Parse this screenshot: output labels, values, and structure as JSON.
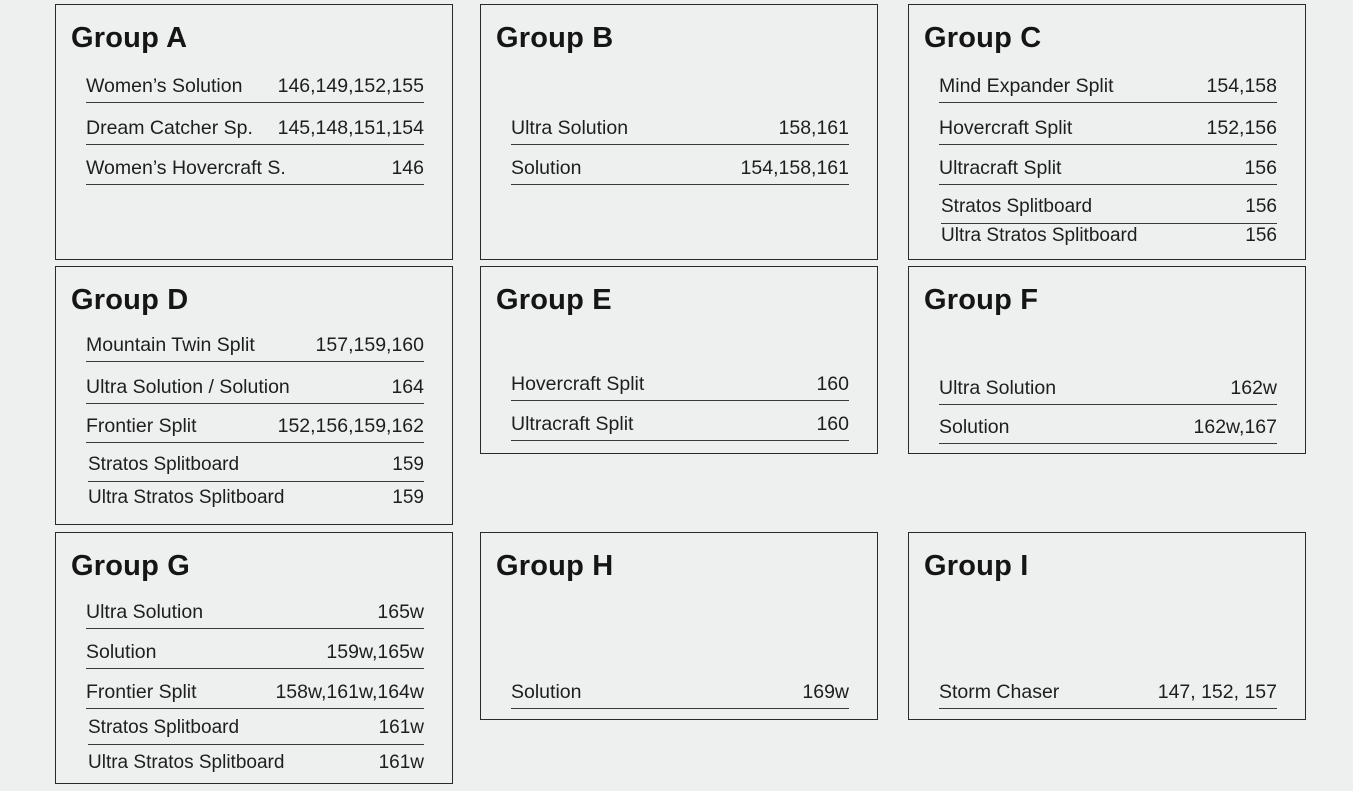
{
  "groups": [
    {
      "title": "Group A",
      "rows": [
        {
          "name": "Women’s Solution",
          "sizes": "146,149,152,155"
        },
        {
          "name": "Dream Catcher Sp.",
          "sizes": "145,148,151,154"
        },
        {
          "name": "Women’s Hovercraft S.",
          "sizes": "146"
        }
      ]
    },
    {
      "title": "Group B",
      "rows": [
        {
          "name": "Ultra Solution",
          "sizes": "158,161"
        },
        {
          "name": "Solution",
          "sizes": "154,158,161"
        }
      ]
    },
    {
      "title": "Group C",
      "rows": [
        {
          "name": "Mind Expander Split",
          "sizes": "154,158"
        },
        {
          "name": "Hovercraft Split",
          "sizes": "152,156"
        },
        {
          "name": "Ultracraft Split",
          "sizes": "156"
        },
        {
          "name": "Stratos Splitboard",
          "sizes": "156"
        },
        {
          "name": "Ultra Stratos Splitboard",
          "sizes": "156"
        }
      ]
    },
    {
      "title": "Group D",
      "rows": [
        {
          "name": "Mountain Twin Split",
          "sizes": "157,159,160"
        },
        {
          "name": "Ultra Solution / Solution",
          "sizes": "164"
        },
        {
          "name": "Frontier Split",
          "sizes": "152,156,159,162"
        },
        {
          "name": "Stratos Splitboard",
          "sizes": "159"
        },
        {
          "name": "Ultra Stratos Splitboard",
          "sizes": "159"
        }
      ]
    },
    {
      "title": "Group E",
      "rows": [
        {
          "name": "Hovercraft Split",
          "sizes": "160"
        },
        {
          "name": "Ultracraft Split",
          "sizes": "160"
        }
      ]
    },
    {
      "title": "Group F",
      "rows": [
        {
          "name": "Ultra Solution",
          "sizes": "162w"
        },
        {
          "name": "Solution",
          "sizes": "162w,167"
        }
      ]
    },
    {
      "title": "Group G",
      "rows": [
        {
          "name": "Ultra Solution",
          "sizes": "165w"
        },
        {
          "name": "Solution",
          "sizes": "159w,165w"
        },
        {
          "name": "Frontier Split",
          "sizes": "158w,161w,164w"
        },
        {
          "name": "Stratos Splitboard",
          "sizes": "161w"
        },
        {
          "name": "Ultra Stratos Splitboard",
          "sizes": "161w"
        }
      ]
    },
    {
      "title": "Group H",
      "rows": [
        {
          "name": "Solution",
          "sizes": "169w"
        }
      ]
    },
    {
      "title": "Group I",
      "rows": [
        {
          "name": "Storm Chaser",
          "sizes": "147, 152, 157"
        }
      ]
    }
  ]
}
